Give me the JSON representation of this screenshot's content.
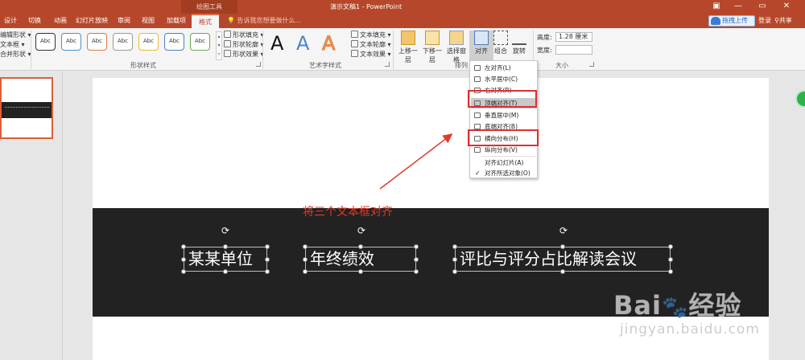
{
  "titlebar": {
    "context_tool": "绘图工具",
    "doc_title": "演示文稿1 - PowerPoint",
    "min": "—",
    "restore": "▭",
    "close": "✕",
    "ribbon_opts": "▣"
  },
  "tabs": [
    "设计",
    "切换",
    "动画",
    "幻灯片放映",
    "审阅",
    "视图",
    "加载项",
    "格式"
  ],
  "tellme": "告诉我您想要做什么...",
  "account": {
    "upload": "拖拽上传",
    "login": "登录",
    "share": "共享"
  },
  "ribbon": {
    "insert_shapes": [
      "编辑形状",
      "文本框",
      "合并形状"
    ],
    "shape_styles_label": "形状样式",
    "shape_style_sample": "Abc",
    "shape_cmds": [
      "形状填充",
      "形状轮廓",
      "形状效果"
    ],
    "wordart_label": "艺术字样式",
    "wordart_sample": "A",
    "wordart_cmds": [
      "文本填充",
      "文本轮廓",
      "文本效果"
    ],
    "arrange_label": "排列",
    "arrange_cmds": [
      "上移一层",
      "下移一层",
      "选择窗格",
      "对齐",
      "组合",
      "旋转"
    ],
    "size_label": "大小",
    "height_label": "高度:",
    "height_value": "1.28 厘米",
    "width_label": "宽度:",
    "width_value": ""
  },
  "slide": {
    "annotation": "将三个文本框对齐",
    "textboxes": [
      "某某单位",
      "年终绩效",
      "评比与评分占比解读会议"
    ]
  },
  "align_menu": {
    "items": [
      "左对齐(L)",
      "水平居中(C)",
      "右对齐(R)",
      "顶端对齐(T)",
      "垂直居中(M)",
      "底端对齐(B)",
      "横向分布(H)",
      "纵向分布(V)",
      "对齐幻灯片(A)",
      "对齐所选对象(O)"
    ],
    "check": "✓"
  },
  "watermark": {
    "brand": "Bai",
    "brand2": "经验",
    "url": "jingyan.baidu.com"
  },
  "colors": {
    "accent": "#b7472a",
    "highlight": "#e12e2e",
    "dark_band": "#222222"
  }
}
